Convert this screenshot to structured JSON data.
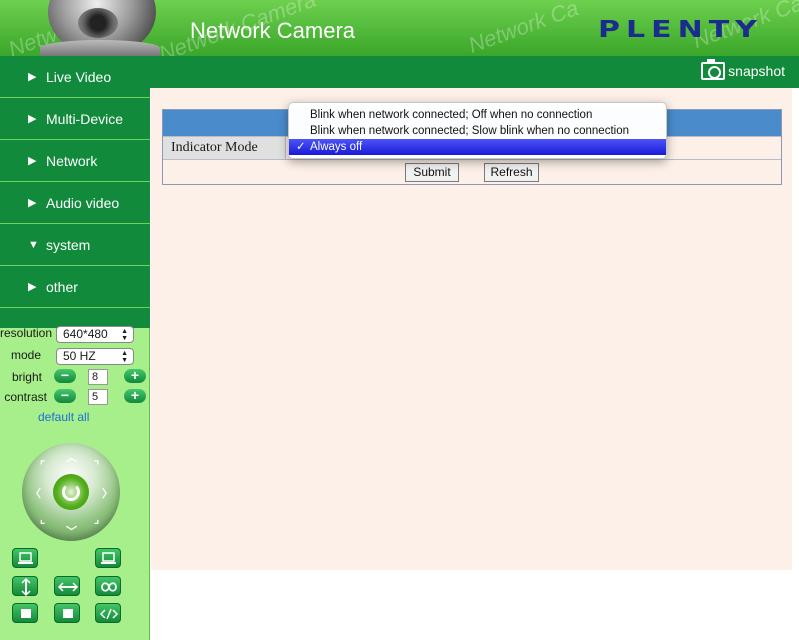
{
  "header": {
    "title": "Network Camera",
    "brand": "PLENTY",
    "watermarks": [
      "Network Ca",
      "Network Camera",
      "Network Ca",
      "Network Cam"
    ]
  },
  "topbar": {
    "snapshot_label": "snapshot"
  },
  "sidebar": {
    "items": [
      {
        "label": "Live Video",
        "arrow": "▶"
      },
      {
        "label": "Multi-Device",
        "arrow": "▶"
      },
      {
        "label": "Network",
        "arrow": "▶"
      },
      {
        "label": "Audio video",
        "arrow": "▶"
      },
      {
        "label": "system",
        "arrow": "▼"
      },
      {
        "label": "other",
        "arrow": "▶"
      }
    ],
    "controls": {
      "resolution_label": "resolution",
      "resolution_value": "640*480",
      "mode_label": "mode",
      "mode_value": "50 HZ",
      "bright_label": "bright",
      "bright_value": "8",
      "contrast_label": "contrast",
      "contrast_value": "5",
      "minus": "−",
      "plus": "+",
      "default_all": "default all"
    }
  },
  "main": {
    "indicator_label": "Indicator Mode",
    "submit_label": "Submit",
    "refresh_label": "Refresh"
  },
  "dropdown": {
    "options": [
      "Blink when network connected; Off when no connection",
      "Blink when network connected; Slow blink when no connection",
      "Always off"
    ],
    "selected_index": 2,
    "check": "✓"
  },
  "colors": {
    "menu_green": "#118a3c",
    "sidebar_bg": "#a6ef8a",
    "table_header": "#4a8ccb",
    "main_bg": "#fcf0e8",
    "selected_option": "#2a2ae8",
    "link": "#1e6fd6"
  }
}
